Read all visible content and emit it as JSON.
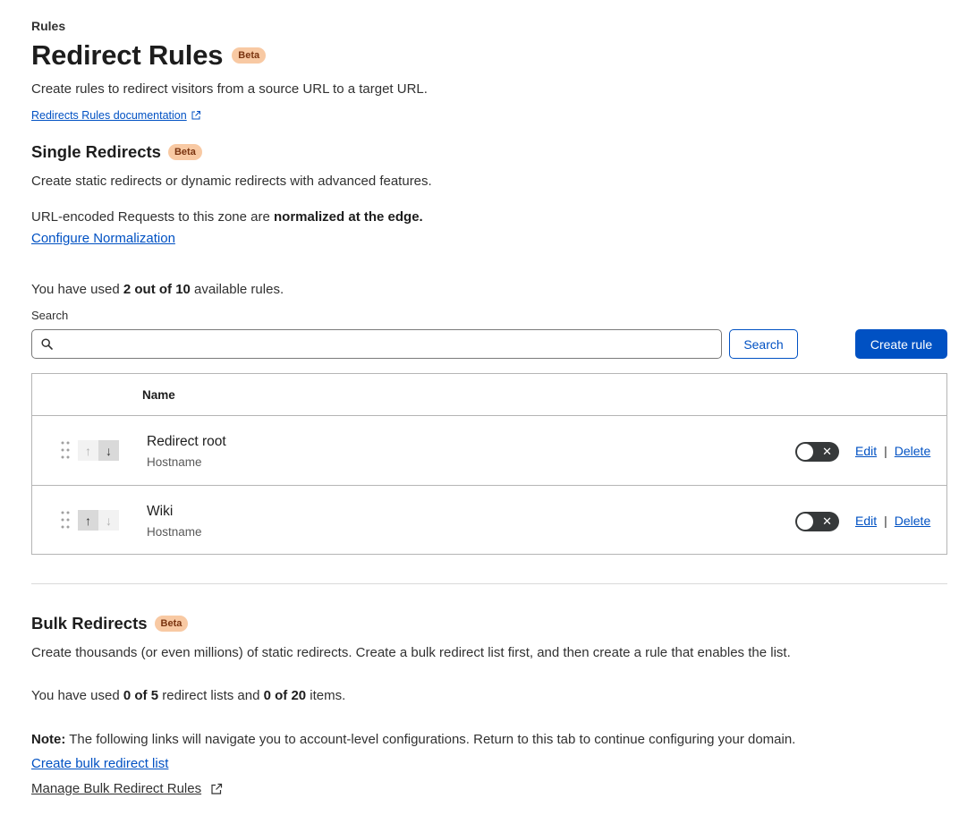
{
  "breadcrumb": "Rules",
  "header": {
    "title": "Redirect Rules",
    "badge": "Beta",
    "subtitle": "Create rules to redirect visitors from a source URL to a target URL.",
    "doc_link": "Redirects Rules documentation"
  },
  "single": {
    "title": "Single Redirects",
    "badge": "Beta",
    "description": "Create static redirects or dynamic redirects with advanced features.",
    "normalization_prefix": "URL-encoded Requests to this zone are ",
    "normalization_bold": "normalized at the edge.",
    "configure_link": "Configure Normalization",
    "usage_prefix": "You have used ",
    "usage_bold": "2 out of 10",
    "usage_suffix": " available rules.",
    "search_label": "Search",
    "search_value": "",
    "search_button": "Search",
    "create_button": "Create rule",
    "table": {
      "header_name": "Name",
      "rows": [
        {
          "name": "Redirect root",
          "type": "Hostname",
          "up_enabled": false,
          "down_enabled": true,
          "enabled": false,
          "edit": "Edit",
          "separator": "|",
          "delete": "Delete"
        },
        {
          "name": "Wiki",
          "type": "Hostname",
          "up_enabled": true,
          "down_enabled": false,
          "enabled": false,
          "edit": "Edit",
          "separator": "|",
          "delete": "Delete"
        }
      ]
    }
  },
  "bulk": {
    "title": "Bulk Redirects",
    "badge": "Beta",
    "description": "Create thousands (or even millions) of static redirects. Create a bulk redirect list first, and then create a rule that enables the list.",
    "usage_prefix": "You have used ",
    "usage_lists": "0 of 5",
    "usage_mid": " redirect lists and ",
    "usage_items": "0 of 20",
    "usage_suffix": " items.",
    "note_bold": "Note:",
    "note_text": " The following links will navigate you to account-level configurations. Return to this tab to continue configuring your domain.",
    "create_list_link": "Create bulk redirect list",
    "manage_link": "Manage Bulk Redirect Rules"
  },
  "icons": {
    "external": "external-link-icon",
    "search": "search-icon",
    "drag": "drag-handle-icon",
    "up": "arrow-up-icon",
    "down": "arrow-down-icon",
    "toggle_x": "close-icon"
  },
  "colors": {
    "accent": "#0051c3",
    "badge_bg": "#f8c9a3",
    "toggle_off": "#36393a"
  }
}
